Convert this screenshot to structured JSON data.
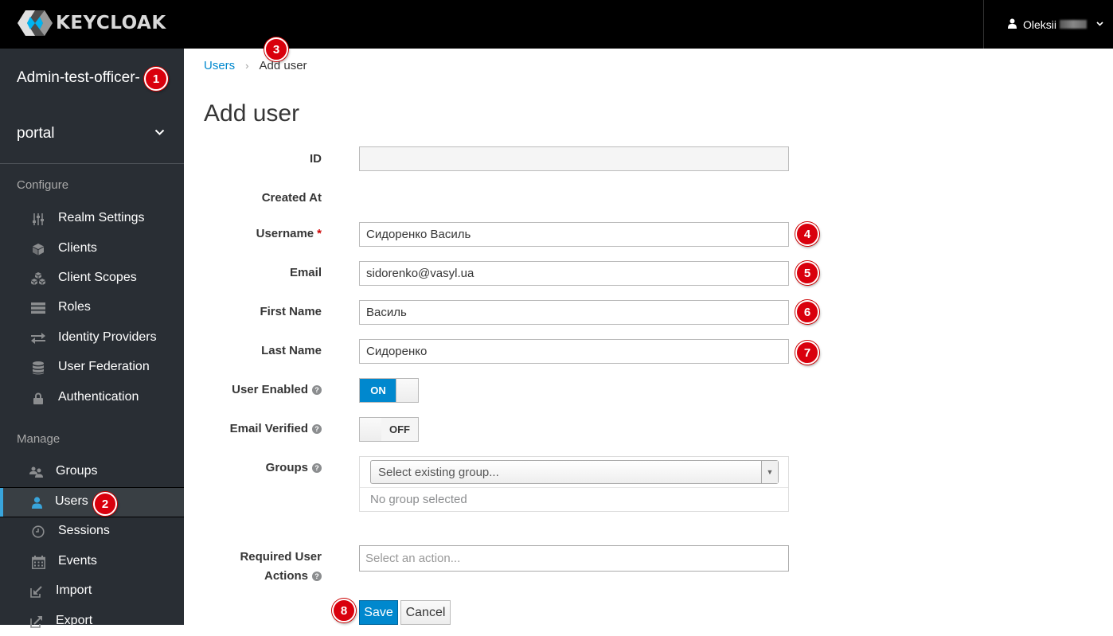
{
  "header": {
    "brand": "KEYCLOAK",
    "user_name": "Oleksii",
    "user_menu_caret": "chevron-down"
  },
  "sidebar": {
    "realm_name": "Admin-test-officer-",
    "realm_selector": "portal",
    "sections": [
      {
        "title": "Configure",
        "items": [
          {
            "label": "Realm Settings",
            "icon": "sliders-icon"
          },
          {
            "label": "Clients",
            "icon": "cube-icon"
          },
          {
            "label": "Client Scopes",
            "icon": "cubes-icon"
          },
          {
            "label": "Roles",
            "icon": "list-icon"
          },
          {
            "label": "Identity Providers",
            "icon": "exchange-icon"
          },
          {
            "label": "User Federation",
            "icon": "database-icon"
          },
          {
            "label": "Authentication",
            "icon": "lock-icon"
          }
        ]
      },
      {
        "title": "Manage",
        "items": [
          {
            "label": "Groups",
            "icon": "users-icon"
          },
          {
            "label": "Users",
            "icon": "user-icon",
            "active": true
          },
          {
            "label": "Sessions",
            "icon": "clock-icon"
          },
          {
            "label": "Events",
            "icon": "calendar-icon"
          },
          {
            "label": "Import",
            "icon": "import-icon"
          },
          {
            "label": "Export",
            "icon": "export-icon"
          }
        ]
      }
    ]
  },
  "breadcrumb": {
    "parent": "Users",
    "separator": "›",
    "current": "Add user"
  },
  "page": {
    "title": "Add user"
  },
  "form": {
    "id": {
      "label": "ID",
      "value": ""
    },
    "created_at": {
      "label": "Created At",
      "value": ""
    },
    "username": {
      "label": "Username",
      "required_mark": "*",
      "value": "Сидоренко Василь"
    },
    "email": {
      "label": "Email",
      "value": "sidorenko@vasyl.ua"
    },
    "first_name": {
      "label": "First Name",
      "value": "Василь"
    },
    "last_name": {
      "label": "Last Name",
      "value": "Сидоренко"
    },
    "user_enabled": {
      "label": "User Enabled",
      "state": "ON"
    },
    "email_verified": {
      "label": "Email Verified",
      "state": "OFF"
    },
    "groups": {
      "label": "Groups",
      "placeholder": "Select existing group...",
      "empty_text": "No group selected"
    },
    "required_actions": {
      "label_line1": "Required User",
      "label_line2": "Actions",
      "placeholder": "Select an action..."
    },
    "help_glyph": "?"
  },
  "buttons": {
    "save": "Save",
    "cancel": "Cancel"
  },
  "annotations": [
    "1",
    "2",
    "3",
    "4",
    "5",
    "6",
    "7",
    "8"
  ],
  "colors": {
    "accent": "#0088ce",
    "sidebar_bg": "#292e34",
    "topbar_bg": "#000000",
    "badge": "#d9000d"
  }
}
